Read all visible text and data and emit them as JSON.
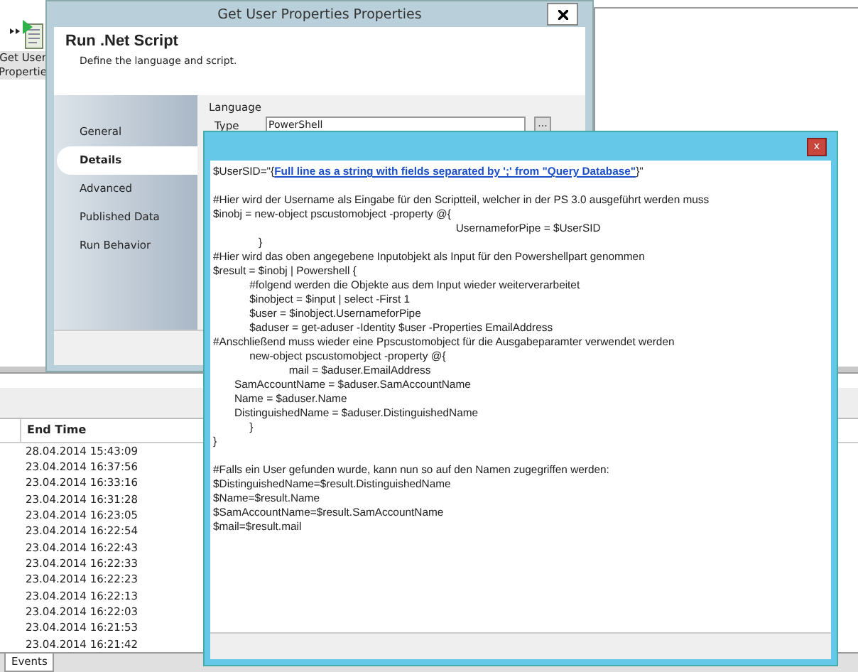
{
  "desktop_icon": {
    "label_lines": [
      "Get User",
      "Propertie"
    ]
  },
  "dialog": {
    "title": "Get User Properties Properties",
    "heading": "Run .Net Script",
    "subheading": "Define the language and script.",
    "nav": [
      {
        "label": "General",
        "selected": false
      },
      {
        "label": "Details",
        "selected": true
      },
      {
        "label": "Advanced",
        "selected": false
      },
      {
        "label": "Published Data",
        "selected": false
      },
      {
        "label": "Run Behavior",
        "selected": false
      }
    ],
    "group_label": "Language",
    "type_label": "Type",
    "type_value": "PowerShell",
    "browse_button": "..."
  },
  "table": {
    "columns": [
      "End Time"
    ],
    "rows": [
      {
        "end_time": "28.04.2014 15:43:09"
      },
      {
        "end_time": "23.04.2014 16:37:56"
      },
      {
        "end_time": "23.04.2014 16:33:16"
      },
      {
        "end_time": "23.04.2014 16:31:28"
      },
      {
        "end_time": "23.04.2014 16:23:05"
      },
      {
        "end_time": "23.04.2014 16:22:54"
      },
      {
        "end_time": "23.04.2014 16:22:43"
      },
      {
        "end_time": "23.04.2014 16:22:33"
      },
      {
        "end_time": "23.04.2014 16:22:23"
      },
      {
        "end_time": "23.04.2014 16:22:13"
      },
      {
        "end_time": "23.04.2014 16:22:03"
      },
      {
        "end_time": "23.04.2014 16:21:53"
      },
      {
        "end_time": "23.04.2014 16:21:42"
      }
    ]
  },
  "bottom_tabs": [
    {
      "label": "Events",
      "selected": true
    }
  ],
  "editor": {
    "close": "x",
    "first_line": {
      "prefix": "$UserSID=\"{",
      "link": "Full line as a string with fields separated by ';' from \"Query Database\"",
      "suffix": "}\""
    },
    "blocks": [
      [
        "#Hier wird der Username als Eingabe für den Scriptteil, welcher in der PS 3.0 ausgeführt werden muss",
        "$inobj = new-object pscustomobject -property @{",
        "                                                                                UsernameforPipe = $UserSID",
        "               }",
        "#Hier wird das oben angegebene Inputobjekt als Input für den Powershellpart genommen",
        "$result = $inobj | Powershell {",
        "            #folgend werden die Objekte aus dem Input wieder weiterverarbeitet",
        "            $inobject = $input | select -First 1",
        "            $user = $inobject.UsernameforPipe",
        "            $aduser = get-aduser -Identity $user -Properties EmailAddress",
        "#Anschließend muss wieder eine Ppscustomobject für die Ausgabeparamter verwendet werden",
        "            new-object pscustomobject -property @{",
        "                         mail = $aduser.EmailAddress",
        "       SamAccountName = $aduser.SamAccountName",
        "       Name = $aduser.Name",
        "       DistinguishedName = $aduser.DistinguishedName",
        "            }",
        "}"
      ],
      [
        "#Falls ein User gefunden wurde, kann nun so auf den Namen zugegriffen werden:",
        "$DistinguishedName=$result.DistinguishedName",
        "$Name=$result.Name",
        "$SamAccountName=$result.SamAccountName",
        "$mail=$result.mail"
      ]
    ]
  }
}
